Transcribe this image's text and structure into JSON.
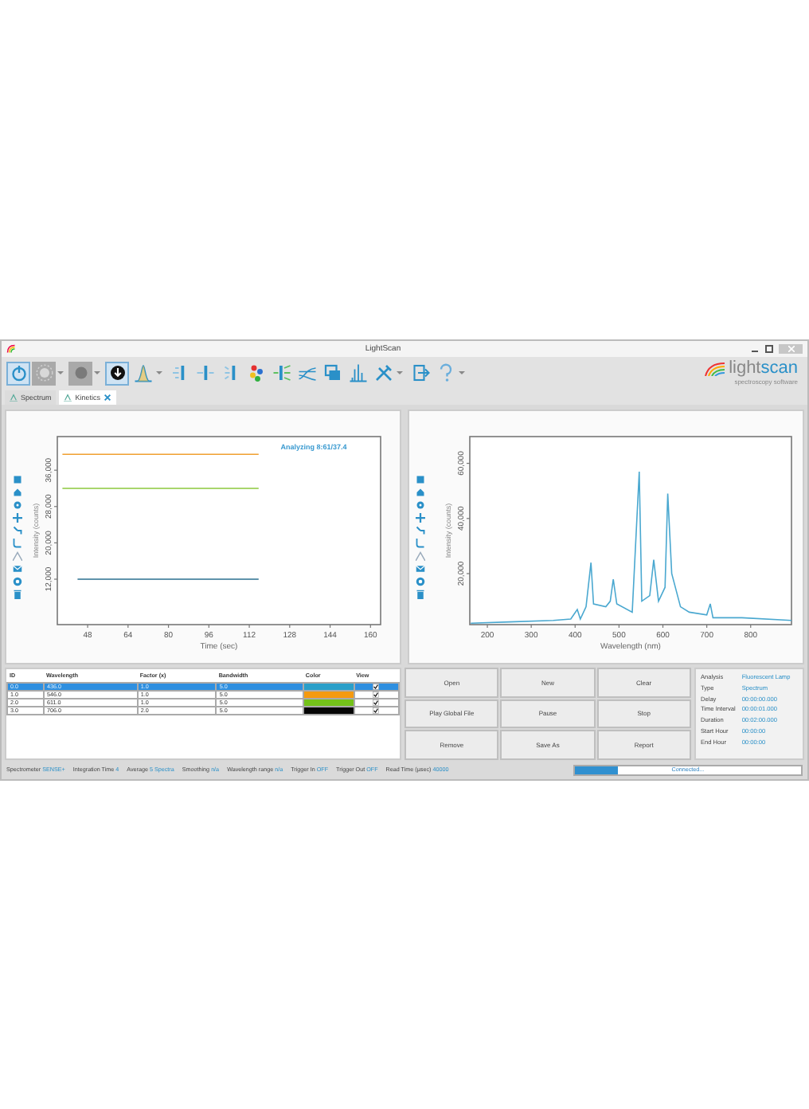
{
  "window": {
    "title": "LightScan"
  },
  "toolbar": [
    {
      "kind": "power",
      "on": true,
      "disabled": false,
      "dropdown": false
    },
    {
      "kind": "lamp",
      "on": false,
      "disabled": true,
      "dropdown": true
    },
    {
      "kind": "shutter",
      "on": false,
      "disabled": true,
      "dropdown": true
    },
    {
      "kind": "download",
      "on": true,
      "disabled": false,
      "dropdown": false
    },
    {
      "kind": "peak",
      "on": false,
      "disabled": false,
      "dropdown": true
    },
    {
      "kind": "bars-left",
      "on": false,
      "disabled": false,
      "dropdown": false
    },
    {
      "kind": "bars-center",
      "on": false,
      "disabled": false,
      "dropdown": false
    },
    {
      "kind": "bars-marks",
      "on": false,
      "disabled": false,
      "dropdown": false
    },
    {
      "kind": "colors",
      "on": false,
      "disabled": false,
      "dropdown": false
    },
    {
      "kind": "rays",
      "on": false,
      "disabled": false,
      "dropdown": false
    },
    {
      "kind": "curves",
      "on": false,
      "disabled": false,
      "dropdown": false
    },
    {
      "kind": "windows",
      "on": false,
      "disabled": false,
      "dropdown": false
    },
    {
      "kind": "spectrum",
      "on": false,
      "disabled": false,
      "dropdown": false
    },
    {
      "kind": "tools",
      "on": false,
      "disabled": false,
      "dropdown": true
    },
    {
      "kind": "exit",
      "on": false,
      "disabled": false,
      "dropdown": false
    },
    {
      "kind": "help",
      "on": false,
      "disabled": false,
      "dropdown": true
    }
  ],
  "logo": {
    "part_1": "light",
    "part_2": "scan",
    "tagline": "spectroscopy software"
  },
  "tabs": [
    {
      "label": "Spectrum",
      "selected": false,
      "closable": false
    },
    {
      "label": "Kinetics",
      "selected": true,
      "closable": true
    }
  ],
  "kinetics_chart": {
    "chart_data": {
      "type": "line",
      "xlabel": "Time (sec)",
      "ylabel": "Intensity (counts)",
      "x": [
        38,
        44,
        50,
        60,
        70,
        80,
        90,
        100,
        110,
        115.7
      ],
      "xlim": [
        36,
        164
      ],
      "ylim": [
        2000,
        43400
      ],
      "xticks": [
        48,
        64,
        80,
        96,
        112,
        128,
        144,
        160
      ],
      "yticks": [
        {
          "value": 12000,
          "label": "12,000"
        },
        {
          "value": 20000,
          "label": "20,000"
        },
        {
          "value": 28000,
          "label": "28,000"
        },
        {
          "value": 36000,
          "label": "36,000"
        }
      ],
      "annotations": [
        "Analyzing 8:61/37.4"
      ],
      "series": [
        {
          "color": "#2a6f8f",
          "values": [
            null,
            12000,
            12000,
            12000,
            12000,
            12000,
            12000,
            12000,
            12000,
            12000
          ]
        },
        {
          "color": "#f0a030",
          "values": [
            39500,
            39500,
            39500,
            39500,
            39500,
            39500,
            39500,
            39500,
            39500,
            39500
          ]
        },
        {
          "color": "#8cc83c",
          "values": [
            32000,
            32000,
            32000,
            32000,
            32000,
            32000,
            32000,
            32000,
            32000,
            32000
          ]
        }
      ]
    }
  },
  "spectrum_chart": {
    "chart_data": {
      "type": "line",
      "xlabel": "Wavelength (nm)",
      "ylabel": "Intensity (counts)",
      "x": [
        162,
        250,
        350,
        390,
        405,
        412,
        425,
        436,
        442,
        470,
        480,
        487,
        495,
        530,
        546,
        552,
        570,
        579,
        590,
        605,
        611,
        620,
        640,
        660,
        700,
        708,
        714,
        780,
        893
      ],
      "xlim": [
        160,
        893
      ],
      "ylim": [
        1500,
        69700
      ],
      "xticks": [
        200,
        300,
        400,
        500,
        600,
        700,
        800
      ],
      "yticks": [
        {
          "value": 20000,
          "label": "20,000"
        },
        {
          "value": 40000,
          "label": "40,000"
        },
        {
          "value": 60000,
          "label": "60,000"
        }
      ],
      "series": [
        {
          "color": "#4aa8d0",
          "values": [
            2000,
            2500,
            3000,
            3500,
            7000,
            3500,
            8000,
            24000,
            9000,
            8000,
            10000,
            18000,
            9000,
            6000,
            57000,
            10000,
            12000,
            25000,
            10000,
            15000,
            49000,
            20000,
            8000,
            6000,
            5000,
            9000,
            4000,
            4000,
            3000
          ]
        }
      ]
    }
  },
  "table": {
    "columns": [
      "ID",
      "Wavelength",
      "Factor (x)",
      "Bandwidth",
      "Color",
      "View"
    ],
    "rows": [
      {
        "cells": [
          "0.0",
          "436.0",
          "1.0",
          "5.0"
        ],
        "color": "#2a9fc9",
        "view": true,
        "selected": true
      },
      {
        "cells": [
          "1.0",
          "546.0",
          "1.0",
          "5.0"
        ],
        "color": "#f59a10",
        "view": true,
        "selected": false
      },
      {
        "cells": [
          "2.0",
          "611.0",
          "1.0",
          "5.0"
        ],
        "color": "#74c21a",
        "view": true,
        "selected": false
      },
      {
        "cells": [
          "3.0",
          "706.0",
          "2.0",
          "5.0"
        ],
        "color": "#050505",
        "view": true,
        "selected": false
      }
    ]
  },
  "buttons": [
    "Open",
    "New",
    "Clear",
    "Play Global File",
    "Pause",
    "Stop",
    "Remove",
    "Save As",
    "Report"
  ],
  "info": [
    {
      "label": "Analysis",
      "value": "Fluorescent Lamp"
    },
    {
      "label": "Type",
      "value": "Spectrum"
    },
    {
      "label": "Delay",
      "value": "00:00:00.000"
    },
    {
      "label": "Time Interval",
      "value": "00:00:01.000"
    },
    {
      "label": "Duration",
      "value": "00:02:00.000"
    },
    {
      "label": "Start Hour",
      "value": "00:00:00"
    },
    {
      "label": "End Hour",
      "value": "00:00:00"
    }
  ],
  "status_bar": {
    "items": [
      {
        "label": "Spectrometer",
        "value": "SENSE+"
      },
      {
        "label": "Integration Time",
        "value": "4"
      },
      {
        "label": "Average",
        "value": "5 Spectra"
      },
      {
        "label": "Smoothing",
        "value": "n/a"
      },
      {
        "label": "Wavelength range",
        "value": "n/a"
      },
      {
        "label": "Trigger In",
        "value": "OFF"
      },
      {
        "label": "Trigger Out",
        "value": "OFF"
      },
      {
        "label": "Read Time (µsec)",
        "value": "40000"
      }
    ],
    "progress": {
      "level": 0.19,
      "text": "Connected..."
    }
  }
}
